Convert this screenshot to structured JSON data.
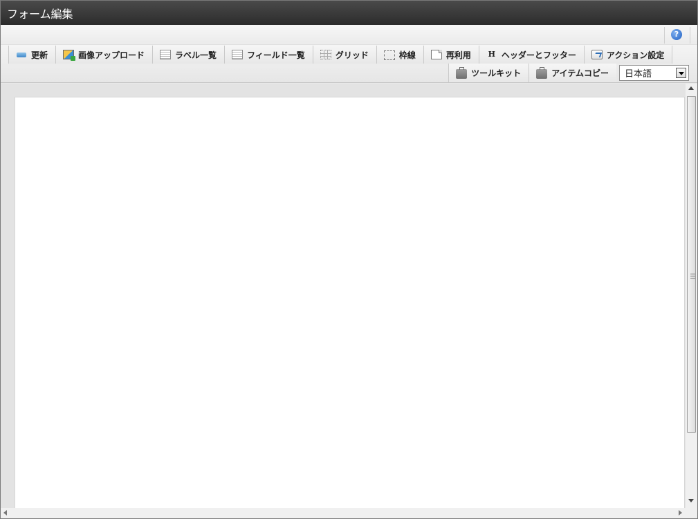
{
  "window": {
    "title": "フォーム編集"
  },
  "help": {
    "icon": "help-icon",
    "glyph": "?"
  },
  "toolbar": {
    "row1": [
      {
        "label": "更新",
        "icon": "refresh-icon"
      },
      {
        "label": "画像アップロード",
        "icon": "image-upload-icon"
      },
      {
        "label": "ラベル一覧",
        "icon": "label-list-icon"
      },
      {
        "label": "フィールド一覧",
        "icon": "field-list-icon"
      },
      {
        "label": "グリッド",
        "icon": "grid-icon"
      },
      {
        "label": "枠線",
        "icon": "border-icon"
      },
      {
        "label": "再利用",
        "icon": "reuse-icon"
      },
      {
        "label": "ヘッダーとフッター",
        "icon": "header-footer-icon",
        "glyph": "H"
      },
      {
        "label": "アクション設定",
        "icon": "action-settings-icon"
      }
    ],
    "row2": [
      {
        "label": "ツールキット",
        "icon": "toolkit-icon"
      },
      {
        "label": "アイテムコピー",
        "icon": "item-copy-icon"
      }
    ],
    "language": {
      "selected": "日本語"
    }
  },
  "colors": {
    "titlebar": "#333333",
    "canvas": "#ffffff",
    "workspace": "#e3e3e3"
  }
}
